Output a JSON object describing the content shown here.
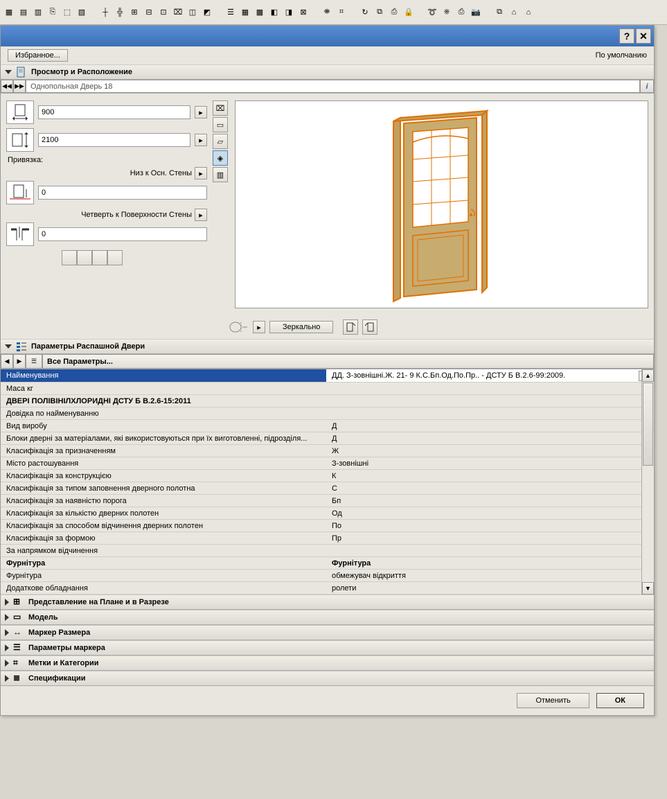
{
  "header": {
    "favorites": "Избранное...",
    "default": "По умолчанию"
  },
  "section_preview": "Просмотр и Расположение",
  "nav_title": "Однопольная Дверь 18",
  "dims": {
    "width": "900",
    "height": "2100",
    "anchor_label": "Привязка:",
    "anchor1_label": "Низ к Осн. Стены",
    "anchor1_value": "0",
    "anchor2_label": "Четверть к Поверхности Стены",
    "anchor2_value": "0"
  },
  "mirror_btn": "Зеркально",
  "section_params": "Параметры Распашной Двери",
  "all_params": "Все Параметры...",
  "params": [
    {
      "k": "Найменування",
      "v": "ДД. З-зовнішні.Ж. 21- 9 К.С.Бп.Од.По.Пр.. - ДСТУ Б В.2.6-99:2009.",
      "selected": true
    },
    {
      "k": "Маса кг",
      "v": ""
    },
    {
      "k": "ДВЕРІ ПОЛІВІНІЛХЛОРИДНІ  ДСТУ Б В.2.6-15:2011",
      "v": "",
      "bold": true
    },
    {
      "k": "Довідка по найменуванню",
      "v": ""
    },
    {
      "k": "Вид виробу",
      "v": "Д"
    },
    {
      "k": "Блоки дверні за матеріалами, які використовуються при їх виготовленні, підрозділя...",
      "v": "Д"
    },
    {
      "k": "Класифікація за призначенням",
      "v": "Ж"
    },
    {
      "k": "Місто растошування",
      "v": "З-зовнішні"
    },
    {
      "k": "Класифікація за конструкцією",
      "v": "К"
    },
    {
      "k": "Класифікація за типом заповнення дверного полотна",
      "v": "С"
    },
    {
      "k": "Класифікація за наявністю порога",
      "v": "Бп"
    },
    {
      "k": "Класифікація за кількістю дверних полотен",
      "v": "Од"
    },
    {
      "k": "Класифікація за способом відчинення дверних полотен",
      "v": "По"
    },
    {
      "k": "Класифікація за формою",
      "v": "Пр"
    },
    {
      "k": "За напрямком відчинення",
      "v": ""
    },
    {
      "k": "Фурнітура",
      "v": "Фурнітура",
      "bold": true
    },
    {
      "k": "Фурнітура",
      "v": "обмежувач відкриття"
    },
    {
      "k": "Додаткове обладнання",
      "v": "ролети"
    }
  ],
  "collapsed_sections": [
    "Представление на Плане и в Разрезе",
    "Модель",
    "Маркер Размера",
    "Параметры маркера",
    "Метки и Категории",
    "Спецификации"
  ],
  "footer": {
    "cancel": "Отменить",
    "ok": "ОК"
  }
}
